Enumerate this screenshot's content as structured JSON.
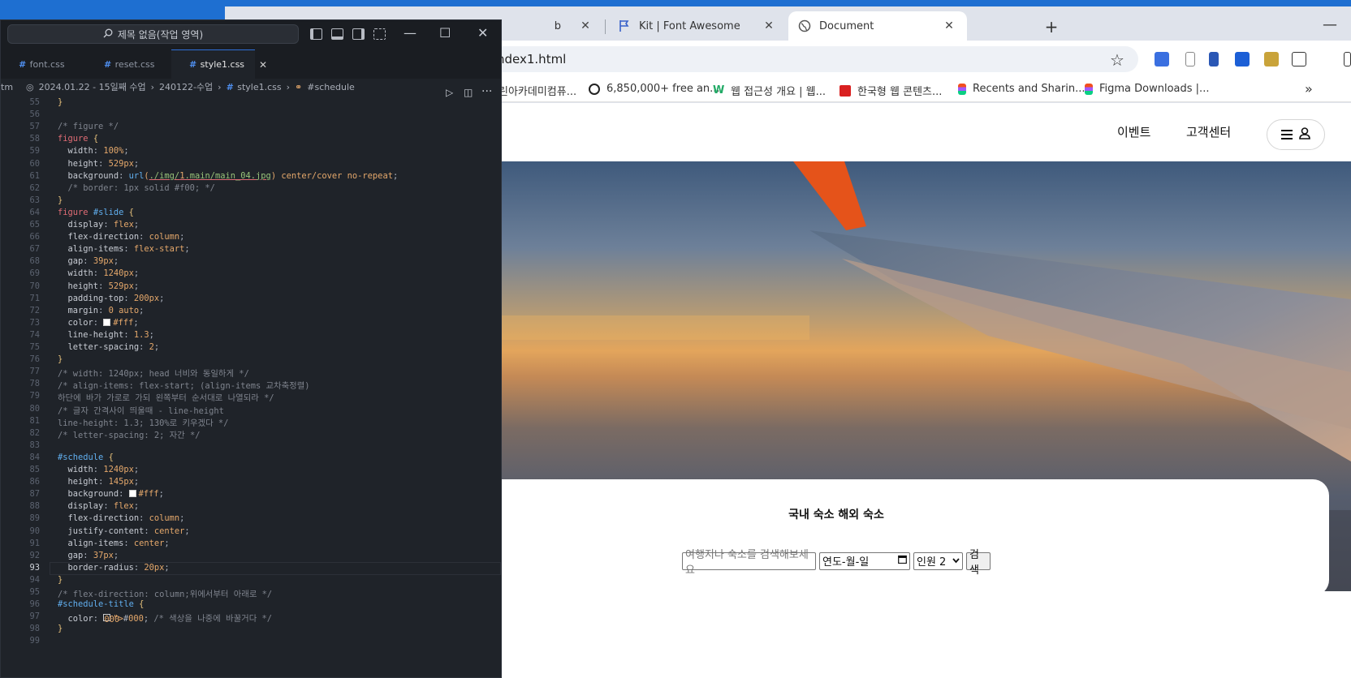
{
  "browser": {
    "tabs": [
      {
        "label": "b",
        "close": "✕"
      },
      {
        "label": "Kit | Font Awesome",
        "close": "✕"
      },
      {
        "label": "Document",
        "close": "✕"
      }
    ],
    "new_tab": "+",
    "minimize": "—",
    "url": "ndex1.html",
    "bookmarks": [
      "린아카데미컴퓨...",
      "6,850,000+ free an...",
      "웹 접근성 개요 | 웹...",
      "한국형 웹 콘텐츠...",
      "Recents and Sharin...",
      "Figma Downloads |..."
    ],
    "more_bookmarks": "»"
  },
  "site": {
    "nav": [
      "이벤트",
      "고객센터"
    ],
    "schedule_title": "국내 숙소 해외 숙소",
    "search_placeholder": "여행지나 숙소를 검색해보세요",
    "date_placeholder": "연도-월-일",
    "people": "인원 2",
    "search_button": "검색"
  },
  "vscode": {
    "command_center": "제목 없음(작업 영역)",
    "tabs": [
      "font.css",
      "reset.css",
      "style1.css"
    ],
    "breadcrumb": [
      "tm",
      "2024.01.22 - 15일째 수업",
      "240122-수업",
      "style1.css",
      "#schedule"
    ],
    "lines": [
      {
        "n": "55",
        "t": "}"
      },
      {
        "n": "56",
        "t": ""
      },
      {
        "n": "57",
        "t": "/* figure */"
      },
      {
        "n": "58",
        "t": "figure {"
      },
      {
        "n": "59",
        "t": "  width: 100%;"
      },
      {
        "n": "60",
        "t": "  height: 529px;"
      },
      {
        "n": "61",
        "t": "  background: url(./img/1.main/main_04.jpg) center/cover no-repeat;"
      },
      {
        "n": "62",
        "t": "  /* border: 1px solid #f00; */"
      },
      {
        "n": "63",
        "t": "}"
      },
      {
        "n": "64",
        "t": "figure #slide {"
      },
      {
        "n": "65",
        "t": "  display: flex;"
      },
      {
        "n": "66",
        "t": "  flex-direction: column;"
      },
      {
        "n": "67",
        "t": "  align-items: flex-start;"
      },
      {
        "n": "68",
        "t": "  gap: 39px;"
      },
      {
        "n": "69",
        "t": "  width: 1240px;"
      },
      {
        "n": "70",
        "t": "  height: 529px;"
      },
      {
        "n": "71",
        "t": "  padding-top: 200px;"
      },
      {
        "n": "72",
        "t": "  margin: 0 auto;"
      },
      {
        "n": "73",
        "t": "  color: #fff;"
      },
      {
        "n": "74",
        "t": "  line-height: 1.3;"
      },
      {
        "n": "75",
        "t": "  letter-spacing: 2;"
      },
      {
        "n": "76",
        "t": "}"
      },
      {
        "n": "77",
        "t": "/* width: 1240px; head 너비와 동일하게 */"
      },
      {
        "n": "78",
        "t": "/* align-items: flex-start; (align-items 교차축정렬)"
      },
      {
        "n": "79",
        "t": "하단에 바가 가로로 가되 왼쪽부터 순서대로 나열되라 */"
      },
      {
        "n": "80",
        "t": "/* 글자 간격사이 띄울때 - line-height"
      },
      {
        "n": "81",
        "t": "line-height: 1.3; 130%로 키우겠다 */"
      },
      {
        "n": "82",
        "t": "/* letter-spacing: 2; 자간 */"
      },
      {
        "n": "83",
        "t": ""
      },
      {
        "n": "84",
        "t": "#schedule {"
      },
      {
        "n": "85",
        "t": "  width: 1240px;"
      },
      {
        "n": "86",
        "t": "  height: 145px;"
      },
      {
        "n": "87",
        "t": "  background: #fff;"
      },
      {
        "n": "88",
        "t": "  display: flex;"
      },
      {
        "n": "89",
        "t": "  flex-direction: column;"
      },
      {
        "n": "90",
        "t": "  justify-content: center;"
      },
      {
        "n": "91",
        "t": "  align-items: center;"
      },
      {
        "n": "92",
        "t": "  gap: 37px;"
      },
      {
        "n": "93",
        "t": "  border-radius: 20px;"
      },
      {
        "n": "94",
        "t": "}"
      },
      {
        "n": "95",
        "t": "/* flex-direction: column;위에서부터 아래로 */"
      },
      {
        "n": "96",
        "t": "#schedule-title {"
      },
      {
        "n": "97",
        "t": "  color: #000; /* 색상을 나중에 바꿀거다 */"
      },
      {
        "n": "98",
        "t": "}"
      },
      {
        "n": "99",
        "t": ""
      }
    ],
    "current_line": "93"
  }
}
